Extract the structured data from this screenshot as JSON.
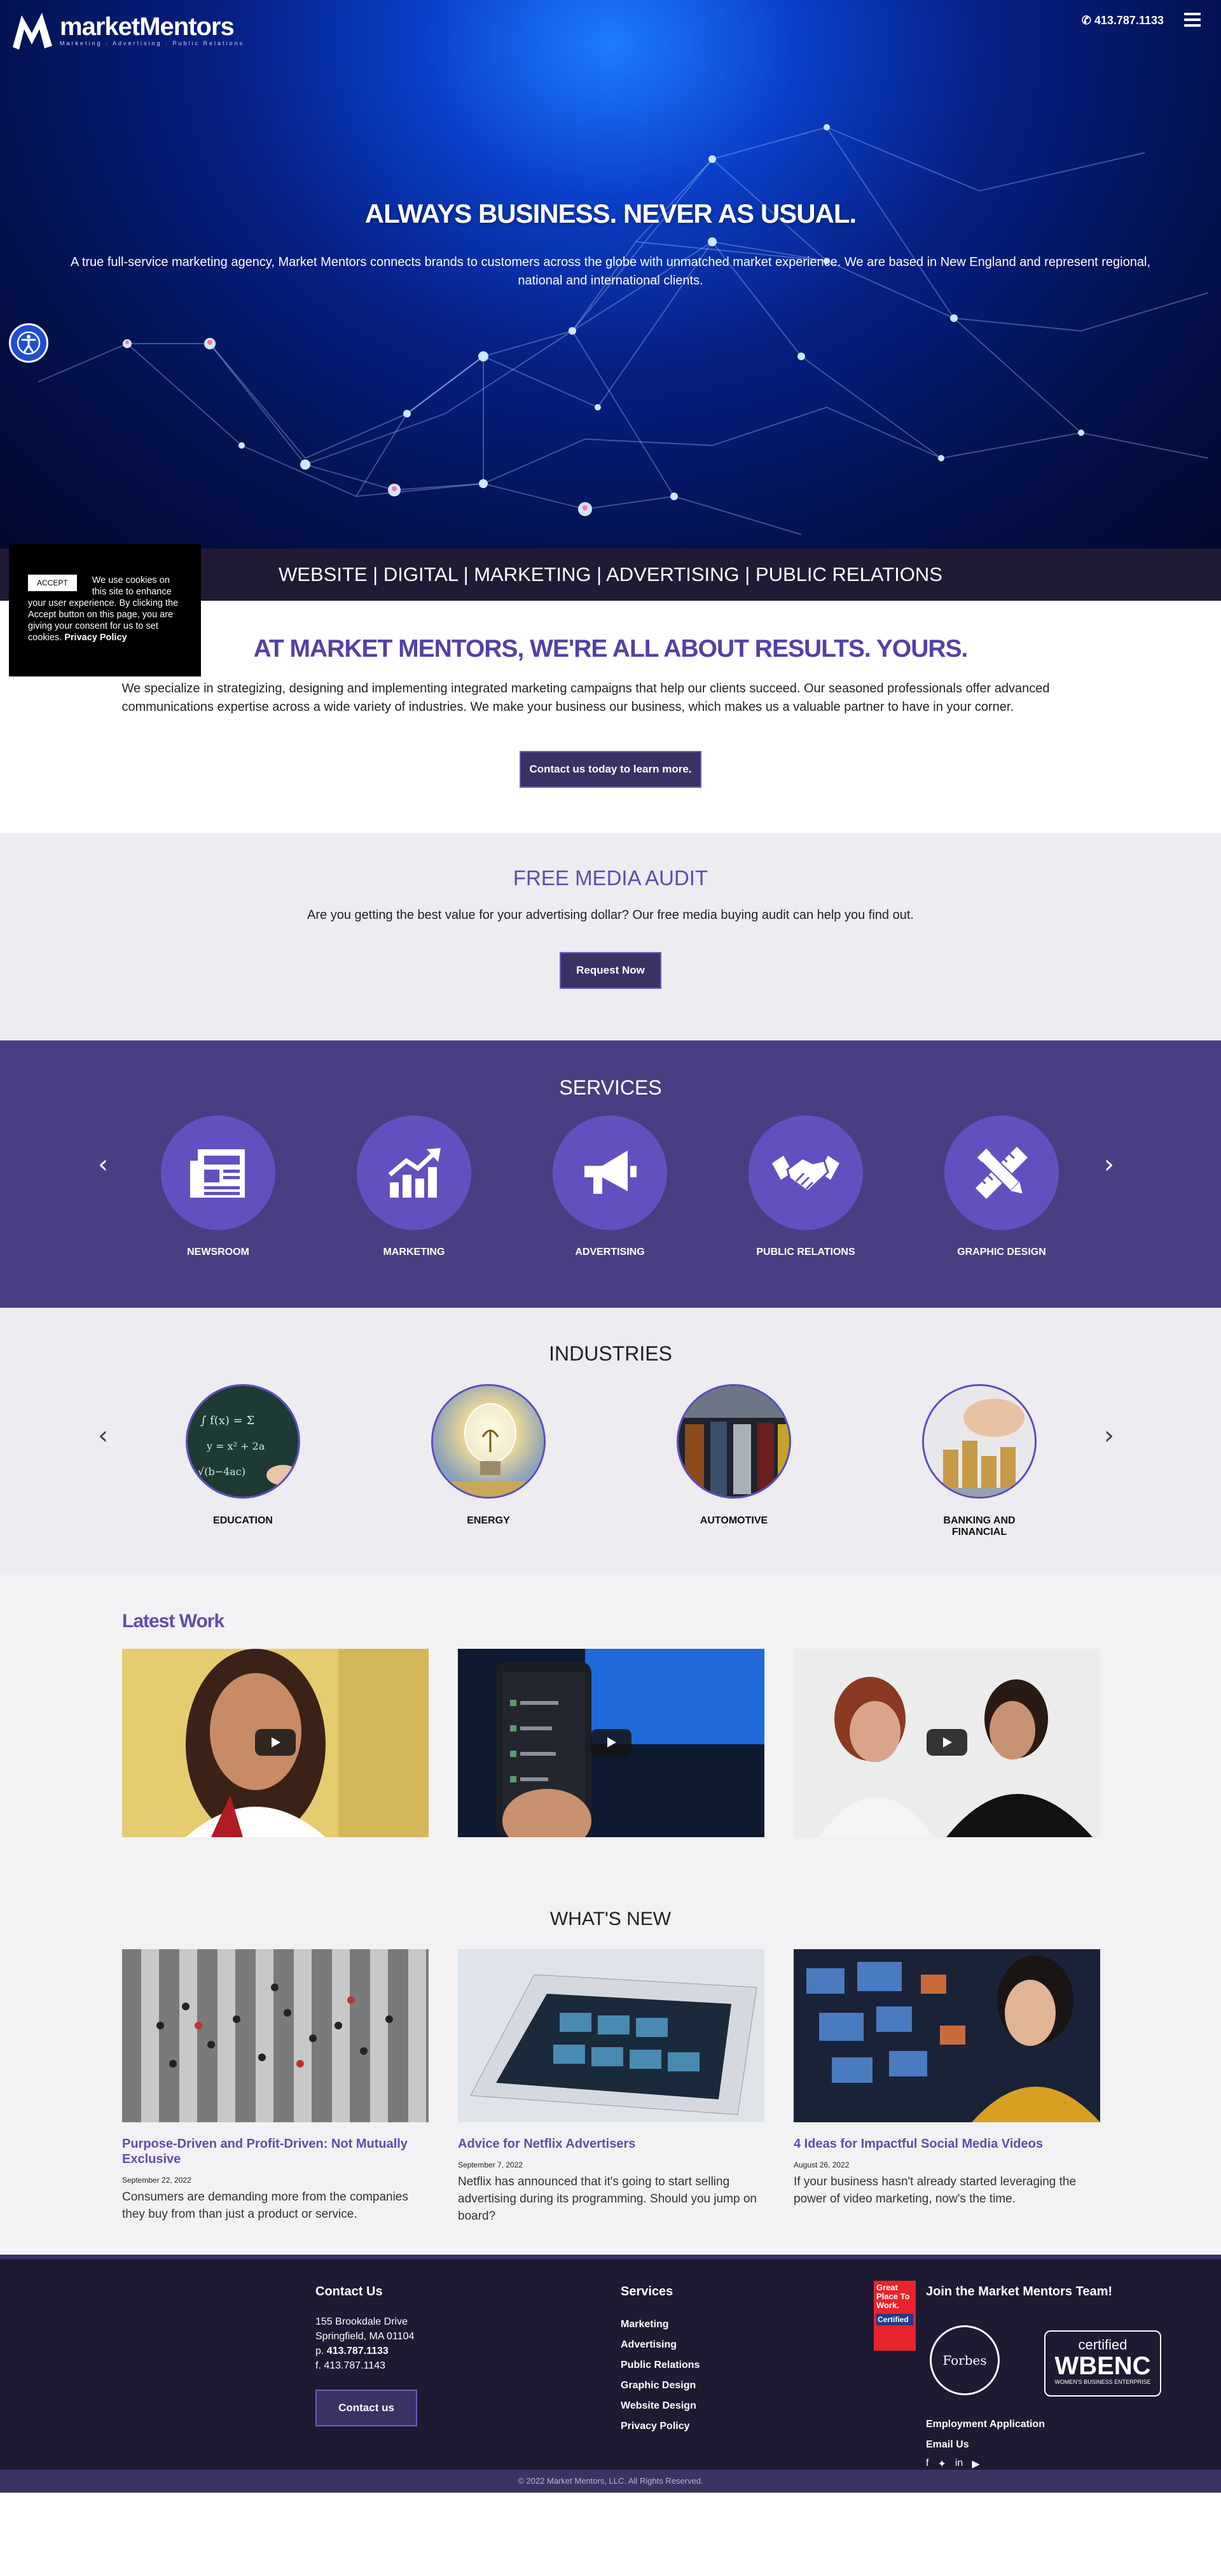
{
  "header": {
    "logo_text": "marketMentors",
    "logo_tagline": "Marketing · Advertising · Public Relations",
    "phone": "413.787.1133"
  },
  "hero": {
    "title": "ALWAYS BUSINESS. NEVER AS USUAL.",
    "text": "A true full-service marketing agency, Market Mentors connects brands to customers across the globe with unmatched market experience. We are based in New England and represent regional, national and international clients."
  },
  "band": {
    "text": "WEBSITE | DIGITAL | MARKETING | ADVERTISING | PUBLIC RELATIONS"
  },
  "cookie": {
    "accept_label": "ACCEPT",
    "text": "We use cookies on this site to enhance your user experience. By clicking the Accept button on this page, you are giving your consent for us to set cookies.",
    "link": "Privacy Policy"
  },
  "results": {
    "title": "AT MARKET MENTORS, WE'RE ALL ABOUT RESULTS. YOURS.",
    "text": "We specialize in strategizing, designing and implementing integrated marketing campaigns that help our clients succeed. Our seasoned professionals offer advanced communications expertise across a wide variety of industries. We make your business our business, which makes us a valuable partner to have in your corner.",
    "button": "Contact us today to learn more."
  },
  "audit": {
    "title": "FREE MEDIA AUDIT",
    "text": "Are you getting the best value for your advertising dollar? Our free media buying audit can help you find out.",
    "button": "Request Now"
  },
  "services": {
    "title": "SERVICES",
    "prev": "‹",
    "next": "›",
    "items": [
      {
        "label": "NEWSROOM",
        "icon": "newspaper-icon"
      },
      {
        "label": "MARKETING",
        "icon": "growth-chart-icon"
      },
      {
        "label": "ADVERTISING",
        "icon": "megaphone-icon"
      },
      {
        "label": "PUBLIC RELATIONS",
        "icon": "handshake-icon"
      },
      {
        "label": "GRAPHIC DESIGN",
        "icon": "pencil-ruler-icon"
      }
    ]
  },
  "industries": {
    "title": "INDUSTRIES",
    "prev": "‹",
    "next": "›",
    "items": [
      {
        "label": "EDUCATION"
      },
      {
        "label": "ENERGY"
      },
      {
        "label": "AUTOMOTIVE"
      },
      {
        "label": "BANKING AND FINANCIAL"
      }
    ]
  },
  "latest": {
    "title": "Latest Work"
  },
  "news": {
    "title": "WHAT'S NEW",
    "items": [
      {
        "title": "Purpose-Driven and Profit-Driven: Not Mutually Exclusive",
        "date": "September 22, 2022",
        "excerpt": "Consumers are demanding more from the companies they buy from than just a product or service."
      },
      {
        "title": "Advice for Netflix Advertisers",
        "date": "September 7, 2022",
        "excerpt": "Netflix has announced that it's going to start selling advertising during its programming. Should you jump on board?"
      },
      {
        "title": "4 Ideas for Impactful Social Media Videos",
        "date": "August 26, 2022",
        "excerpt": "If your business hasn't already started leveraging the power of video marketing, now's the time."
      }
    ]
  },
  "footer": {
    "contact_title": "Contact Us",
    "address1": "155 Brookdale Drive",
    "address2": "Springfield, MA 01104",
    "phone_label": "p.",
    "phone": "413.787.1133",
    "fax": "f. 413.787.1143",
    "contact_button": "Contact us",
    "services_title": "Services",
    "services_links": [
      "Marketing",
      "Advertising",
      "Public Relations",
      "Graphic Design",
      "Website Design",
      "Privacy Policy"
    ],
    "join_title": "Join the Market Mentors Team!",
    "gptw_text": "Great Place To Work.",
    "gptw_certified": "Certified",
    "forbes": "Forbes",
    "wbenc_top": "certified",
    "wbenc": "WBENC",
    "wbenc_sub": "WOMEN'S BUSINESS ENTERPRISE",
    "employment": "Employment Application",
    "email": "Email Us",
    "copyright": "© 2022 Market Mentors, LLC. All Rights Reserved."
  }
}
